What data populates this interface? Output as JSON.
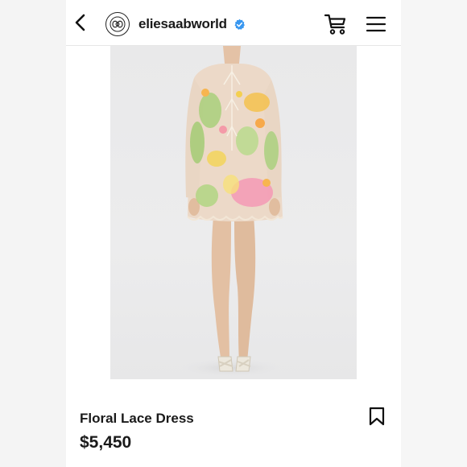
{
  "header": {
    "account_name": "eliesaabworld",
    "icons": {
      "back": "chevron-left-icon",
      "avatar": "brand-logo",
      "verified": "verified-badge-icon",
      "cart": "shopping-cart-icon",
      "menu": "hamburger-menu-icon"
    },
    "verified_color": "#3897f0"
  },
  "product": {
    "title": "Floral Lace Dress",
    "price": "$5,450",
    "image": "model wearing sheer floral embroidered lace mini dress with long sleeves and white strappy heels",
    "save_icon": "bookmark-icon"
  }
}
